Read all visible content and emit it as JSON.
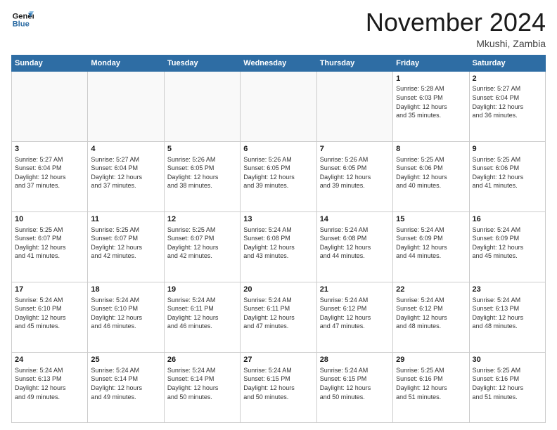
{
  "header": {
    "logo_line1": "General",
    "logo_line2": "Blue",
    "month_title": "November 2024",
    "location": "Mkushi, Zambia"
  },
  "weekdays": [
    "Sunday",
    "Monday",
    "Tuesday",
    "Wednesday",
    "Thursday",
    "Friday",
    "Saturday"
  ],
  "weeks": [
    [
      {
        "day": "",
        "info": ""
      },
      {
        "day": "",
        "info": ""
      },
      {
        "day": "",
        "info": ""
      },
      {
        "day": "",
        "info": ""
      },
      {
        "day": "",
        "info": ""
      },
      {
        "day": "1",
        "info": "Sunrise: 5:28 AM\nSunset: 6:03 PM\nDaylight: 12 hours\nand 35 minutes."
      },
      {
        "day": "2",
        "info": "Sunrise: 5:27 AM\nSunset: 6:04 PM\nDaylight: 12 hours\nand 36 minutes."
      }
    ],
    [
      {
        "day": "3",
        "info": "Sunrise: 5:27 AM\nSunset: 6:04 PM\nDaylight: 12 hours\nand 37 minutes."
      },
      {
        "day": "4",
        "info": "Sunrise: 5:27 AM\nSunset: 6:04 PM\nDaylight: 12 hours\nand 37 minutes."
      },
      {
        "day": "5",
        "info": "Sunrise: 5:26 AM\nSunset: 6:05 PM\nDaylight: 12 hours\nand 38 minutes."
      },
      {
        "day": "6",
        "info": "Sunrise: 5:26 AM\nSunset: 6:05 PM\nDaylight: 12 hours\nand 39 minutes."
      },
      {
        "day": "7",
        "info": "Sunrise: 5:26 AM\nSunset: 6:05 PM\nDaylight: 12 hours\nand 39 minutes."
      },
      {
        "day": "8",
        "info": "Sunrise: 5:25 AM\nSunset: 6:06 PM\nDaylight: 12 hours\nand 40 minutes."
      },
      {
        "day": "9",
        "info": "Sunrise: 5:25 AM\nSunset: 6:06 PM\nDaylight: 12 hours\nand 41 minutes."
      }
    ],
    [
      {
        "day": "10",
        "info": "Sunrise: 5:25 AM\nSunset: 6:07 PM\nDaylight: 12 hours\nand 41 minutes."
      },
      {
        "day": "11",
        "info": "Sunrise: 5:25 AM\nSunset: 6:07 PM\nDaylight: 12 hours\nand 42 minutes."
      },
      {
        "day": "12",
        "info": "Sunrise: 5:25 AM\nSunset: 6:07 PM\nDaylight: 12 hours\nand 42 minutes."
      },
      {
        "day": "13",
        "info": "Sunrise: 5:24 AM\nSunset: 6:08 PM\nDaylight: 12 hours\nand 43 minutes."
      },
      {
        "day": "14",
        "info": "Sunrise: 5:24 AM\nSunset: 6:08 PM\nDaylight: 12 hours\nand 44 minutes."
      },
      {
        "day": "15",
        "info": "Sunrise: 5:24 AM\nSunset: 6:09 PM\nDaylight: 12 hours\nand 44 minutes."
      },
      {
        "day": "16",
        "info": "Sunrise: 5:24 AM\nSunset: 6:09 PM\nDaylight: 12 hours\nand 45 minutes."
      }
    ],
    [
      {
        "day": "17",
        "info": "Sunrise: 5:24 AM\nSunset: 6:10 PM\nDaylight: 12 hours\nand 45 minutes."
      },
      {
        "day": "18",
        "info": "Sunrise: 5:24 AM\nSunset: 6:10 PM\nDaylight: 12 hours\nand 46 minutes."
      },
      {
        "day": "19",
        "info": "Sunrise: 5:24 AM\nSunset: 6:11 PM\nDaylight: 12 hours\nand 46 minutes."
      },
      {
        "day": "20",
        "info": "Sunrise: 5:24 AM\nSunset: 6:11 PM\nDaylight: 12 hours\nand 47 minutes."
      },
      {
        "day": "21",
        "info": "Sunrise: 5:24 AM\nSunset: 6:12 PM\nDaylight: 12 hours\nand 47 minutes."
      },
      {
        "day": "22",
        "info": "Sunrise: 5:24 AM\nSunset: 6:12 PM\nDaylight: 12 hours\nand 48 minutes."
      },
      {
        "day": "23",
        "info": "Sunrise: 5:24 AM\nSunset: 6:13 PM\nDaylight: 12 hours\nand 48 minutes."
      }
    ],
    [
      {
        "day": "24",
        "info": "Sunrise: 5:24 AM\nSunset: 6:13 PM\nDaylight: 12 hours\nand 49 minutes."
      },
      {
        "day": "25",
        "info": "Sunrise: 5:24 AM\nSunset: 6:14 PM\nDaylight: 12 hours\nand 49 minutes."
      },
      {
        "day": "26",
        "info": "Sunrise: 5:24 AM\nSunset: 6:14 PM\nDaylight: 12 hours\nand 50 minutes."
      },
      {
        "day": "27",
        "info": "Sunrise: 5:24 AM\nSunset: 6:15 PM\nDaylight: 12 hours\nand 50 minutes."
      },
      {
        "day": "28",
        "info": "Sunrise: 5:24 AM\nSunset: 6:15 PM\nDaylight: 12 hours\nand 50 minutes."
      },
      {
        "day": "29",
        "info": "Sunrise: 5:25 AM\nSunset: 6:16 PM\nDaylight: 12 hours\nand 51 minutes."
      },
      {
        "day": "30",
        "info": "Sunrise: 5:25 AM\nSunset: 6:16 PM\nDaylight: 12 hours\nand 51 minutes."
      }
    ]
  ]
}
